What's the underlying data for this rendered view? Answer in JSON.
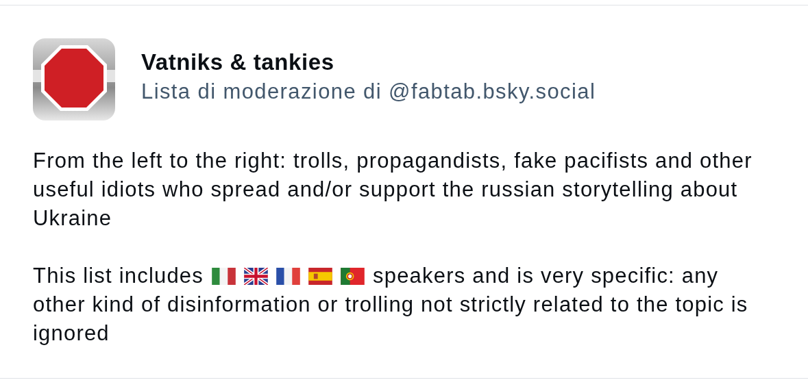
{
  "list": {
    "kind": "picture",
    "title": "Vatniks & tankies",
    "subtitle": "Lista di moderazione di @fabtab.bsky.social"
  },
  "description": {
    "paragraph_1": "From the left to the right: trolls, propagandists, fake pacifists and other useful idiots who spread and/or support the russian storytelling about Ukraine",
    "paragraph_2_before_flags": "This list includes",
    "paragraph_2_after_flags": "speakers and is very specific: any",
    "paragraph_2_rest": "other kind of disinformation or trolling not strictly related to the topic is ignored"
  }
}
